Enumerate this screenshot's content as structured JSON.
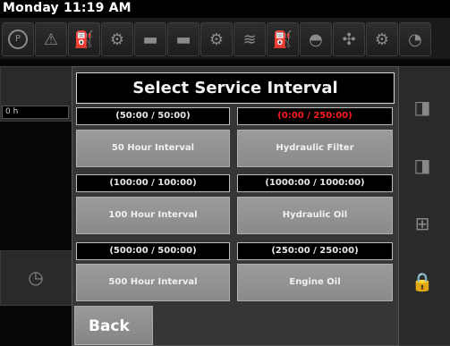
{
  "header": {
    "day": "Monday",
    "time": "11:19 AM"
  },
  "icons": [
    "parking-brake-icon",
    "warning-icon",
    "hydraulic-filter-icon",
    "engine-icon",
    "battery-icon",
    "battery-alt-icon",
    "transmission-icon",
    "glow-plug-icon",
    "fuel-icon",
    "engine-oil-icon",
    "fan-icon"
  ],
  "modal": {
    "title": "Select Service Interval",
    "items": [
      {
        "value": "(50:00 / 50:00)",
        "label": "50 Hour Interval",
        "alert": false
      },
      {
        "value": "(0:00 / 250:00)",
        "label": "Hydraulic Filter",
        "alert": true
      },
      {
        "value": "(100:00 / 100:00)",
        "label": "100 Hour Interval",
        "alert": false
      },
      {
        "value": "(1000:00 / 1000:00)",
        "label": "Hydraulic Oil",
        "alert": false
      },
      {
        "value": "(500:00 / 500:00)",
        "label": "500 Hour Interval",
        "alert": false
      },
      {
        "value": "(250:00 / 250:00)",
        "label": "Engine Oil",
        "alert": false
      }
    ],
    "back_label": "Back"
  },
  "background": {
    "left_value": "0 h"
  },
  "colors": {
    "alert": "#ff1a1a",
    "button": "#8f8f8f",
    "field_bg": "#000000"
  }
}
